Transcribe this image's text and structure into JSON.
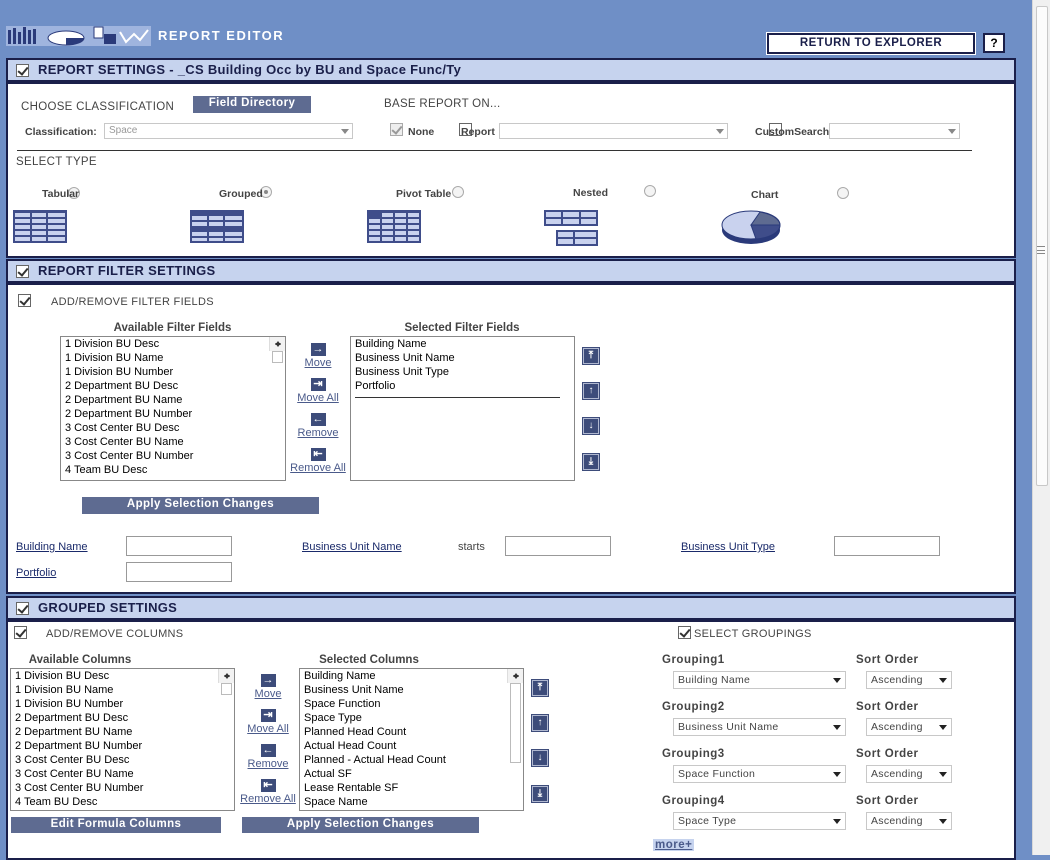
{
  "header": {
    "title": "REPORT EDITOR",
    "return_label": "RETURN TO EXPLORER",
    "help_label": "?"
  },
  "report_settings": {
    "header": "REPORT SETTINGS - _CS Building Occ by BU and Space Func/Ty",
    "choose_classification": "CHOOSE CLASSIFICATION",
    "field_directory": "Field Directory",
    "base_report_on": "BASE REPORT ON...",
    "classification_label": "Classification:",
    "classification_value": "Space",
    "none_label": "None",
    "report_label": "Report",
    "customsearch_label": "CustomSearch",
    "select_type": "SELECT TYPE",
    "types": [
      {
        "label": "Tabular",
        "icon": "tabular-icon",
        "selected": false
      },
      {
        "label": "Grouped",
        "icon": "grouped-icon",
        "selected": true
      },
      {
        "label": "Pivot Table",
        "icon": "pivot-table-icon",
        "selected": false
      },
      {
        "label": "Nested",
        "icon": "nested-icon",
        "selected": false
      },
      {
        "label": "Chart",
        "icon": "pie-chart-icon",
        "selected": false
      }
    ]
  },
  "filter_settings": {
    "header": "REPORT FILTER SETTINGS",
    "add_remove": "ADD/REMOVE FILTER FIELDS",
    "available_title": "Available Filter Fields",
    "selected_title": "Selected Filter Fields",
    "available": [
      "1 Division BU Desc",
      "1 Division BU Name",
      "1 Division BU Number",
      "2 Department BU Desc",
      "2 Department BU Name",
      "2 Department BU Number",
      "3 Cost Center BU Desc",
      "3 Cost Center BU Name",
      "3 Cost Center BU Number",
      "4 Team BU Desc"
    ],
    "selected": [
      "Building Name",
      "Business Unit Name",
      "Business Unit Type",
      "Portfolio"
    ],
    "move": "Move",
    "move_all": "Move All",
    "remove": "Remove",
    "remove_all": "Remove All",
    "apply": "Apply Selection Changes",
    "fields": {
      "building_name": "Building Name",
      "business_unit_name": "Business Unit Name",
      "starts": "starts",
      "business_unit_type": "Business Unit Type",
      "portfolio": "Portfolio"
    }
  },
  "grouped_settings": {
    "header": "GROUPED SETTINGS",
    "add_remove": "ADD/REMOVE COLUMNS",
    "select_groupings": "SELECT GROUPINGS",
    "available_title": "Available Columns",
    "selected_title": "Selected Columns",
    "available": [
      "1 Division BU Desc",
      "1 Division BU Name",
      "1 Division BU Number",
      "2 Department BU Desc",
      "2 Department BU Name",
      "2 Department BU Number",
      "3 Cost Center BU Desc",
      "3 Cost Center BU Name",
      "3 Cost Center BU Number",
      "4 Team BU Desc"
    ],
    "selected": [
      "Building Name",
      "Business Unit Name",
      "Space Function",
      "Space Type",
      "Planned Head Count",
      "Actual Head Count",
      "Planned - Actual Head Count",
      "Actual SF",
      "Lease Rentable SF",
      "Space Name"
    ],
    "move": "Move",
    "move_all": "Move All",
    "remove": "Remove",
    "remove_all": "Remove All",
    "edit_formula": "Edit Formula Columns",
    "apply": "Apply Selection Changes",
    "sort_order_label": "Sort Order",
    "groupings": [
      {
        "label": "Grouping1",
        "value": "Building Name",
        "sort": "Ascending"
      },
      {
        "label": "Grouping2",
        "value": "Business Unit Name",
        "sort": "Ascending"
      },
      {
        "label": "Grouping3",
        "value": "Space Function",
        "sort": "Ascending"
      },
      {
        "label": "Grouping4",
        "value": "Space Type",
        "sort": "Ascending"
      }
    ],
    "more": "more+"
  }
}
